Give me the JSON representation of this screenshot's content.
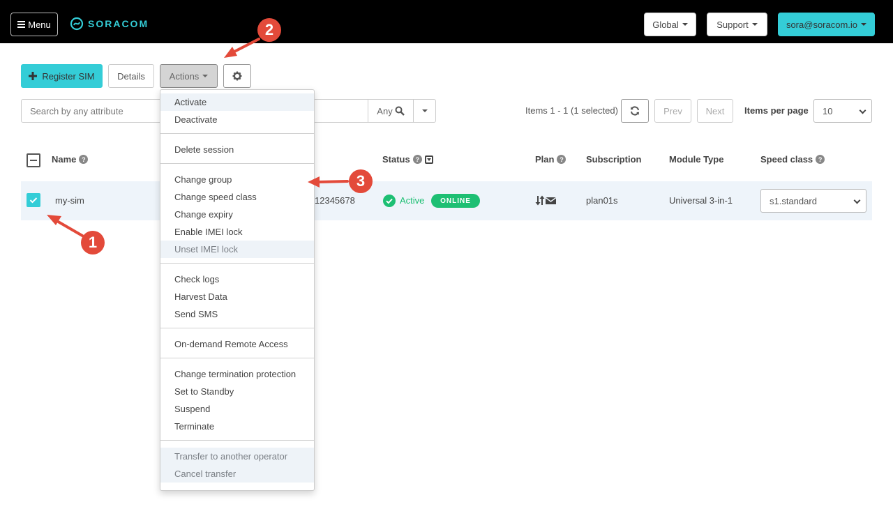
{
  "topbar": {
    "menu_label": "Menu",
    "logo_text": "SORACOM",
    "global_label": "Global",
    "support_label": "Support",
    "account_label": "sora@soracom.io"
  },
  "toolbar": {
    "register_label": "Register SIM",
    "details_label": "Details",
    "actions_label": "Actions",
    "settings_icon": "gear-icon"
  },
  "search": {
    "placeholder": "Search by attribute",
    "placeholder_full": "Search by any attribute",
    "value": "",
    "scope_label": "Any"
  },
  "pagination": {
    "info": "Items 1 - 1 (1 selected)",
    "prev_label": "Prev",
    "next_label": "Next",
    "items_per_page_label": "Items per page",
    "items_per_page_value": "10"
  },
  "table": {
    "columns": [
      {
        "label": "Name",
        "help": true
      },
      {
        "label": "Status",
        "help": true
      },
      {
        "label": "Plan",
        "help": true
      },
      {
        "label": "Subscription",
        "help": false
      },
      {
        "label": "Module Type",
        "help": false
      },
      {
        "label": "Speed class",
        "help": true
      }
    ],
    "rows": [
      {
        "selected": true,
        "name": "my-sim",
        "id_partial": "12345678",
        "status": "Active",
        "online_badge": "ONLINE",
        "subscription": "plan01s",
        "module_type": "Universal 3-in-1",
        "speed_class": "s1.standard"
      }
    ]
  },
  "actions_menu": {
    "groups": [
      [
        "Activate",
        "Deactivate"
      ],
      [
        "Delete session"
      ],
      [
        "Change group",
        "Change speed class",
        "Change expiry",
        "Enable IMEI lock",
        "Unset IMEI lock"
      ],
      [
        "Check logs",
        "Harvest Data",
        "Send SMS"
      ],
      [
        "On-demand Remote Access"
      ],
      [
        "Change termination protection",
        "Set to Standby",
        "Suspend",
        "Terminate"
      ],
      [
        "Transfer to another operator",
        "Cancel transfer"
      ]
    ]
  },
  "annotations": {
    "markers": [
      "1",
      "2",
      "3"
    ],
    "color": "#e34a3a"
  },
  "colors": {
    "brand": "#34cdd7",
    "online": "#1dbf73",
    "active_text": "#1dbf73"
  }
}
